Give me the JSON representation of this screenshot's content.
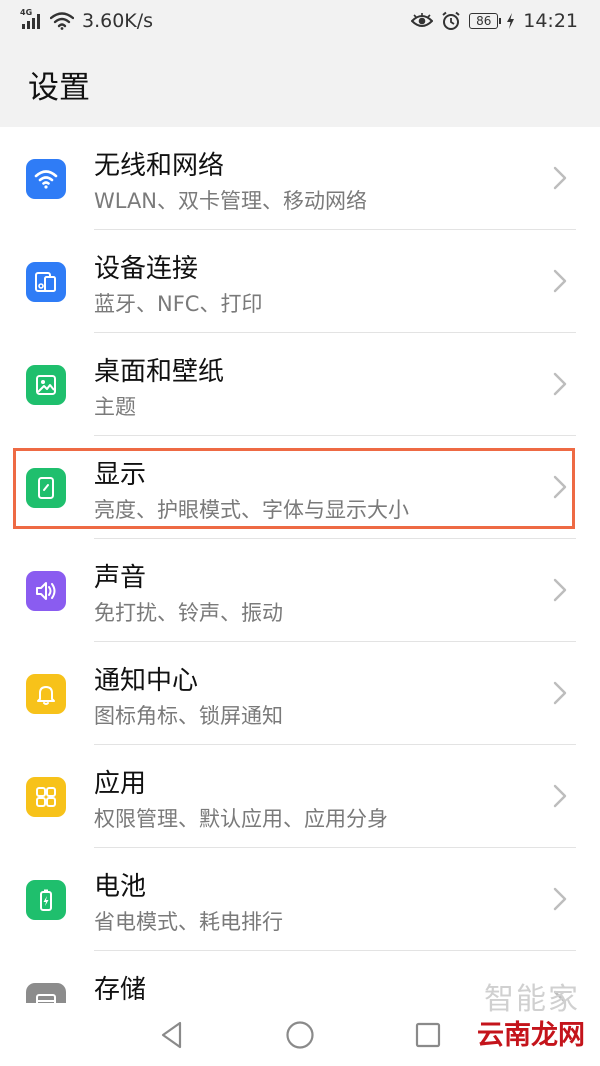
{
  "status_bar": {
    "network_tag": "4G",
    "speed": "3.60K/s",
    "battery": "86",
    "time": "14:21"
  },
  "header": {
    "title": "设置"
  },
  "items": [
    {
      "icon": "wifi-icon",
      "color": "#2f7cf6",
      "title": "无线和网络",
      "subtitle": "WLAN、双卡管理、移动网络"
    },
    {
      "icon": "device-connect-icon",
      "color": "#2f7cf6",
      "title": "设备连接",
      "subtitle": "蓝牙、NFC、打印"
    },
    {
      "icon": "wallpaper-icon",
      "color": "#1fbf6d",
      "title": "桌面和壁纸",
      "subtitle": "主题"
    },
    {
      "icon": "display-icon",
      "color": "#1fbf6d",
      "title": "显示",
      "subtitle": "亮度、护眼模式、字体与显示大小"
    },
    {
      "icon": "sound-icon",
      "color": "#8a5cf0",
      "title": "声音",
      "subtitle": "免打扰、铃声、振动"
    },
    {
      "icon": "bell-icon",
      "color": "#f7c21a",
      "title": "通知中心",
      "subtitle": "图标角标、锁屏通知"
    },
    {
      "icon": "apps-icon",
      "color": "#f7c21a",
      "title": "应用",
      "subtitle": "权限管理、默认应用、应用分身"
    },
    {
      "icon": "battery-icon",
      "color": "#1fbf6d",
      "title": "电池",
      "subtitle": "省电模式、耗电排行"
    },
    {
      "icon": "storage-icon",
      "color": "#8c8c8c",
      "title": "存储",
      "subtitle": ""
    }
  ],
  "colors": {
    "highlight": "#ee6a44",
    "watermark": "#c4141b"
  },
  "watermark": {
    "text": "云南龙网",
    "ghost_text": "智能家"
  }
}
